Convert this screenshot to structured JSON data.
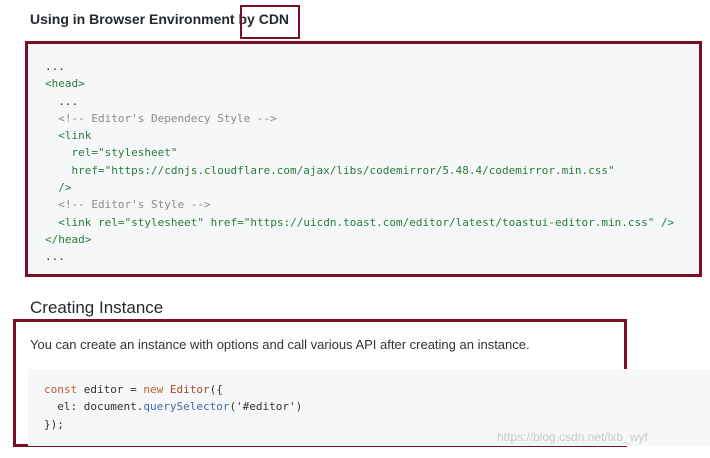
{
  "section_heading": {
    "text_before": "Using in Browser Environment b",
    "text_after": "y CDN"
  },
  "code_block_1": {
    "line_1": "...",
    "line_2_tag": "<head>",
    "line_3": "...",
    "line_4_comment": "<!-- Editor's Dependecy Style -->",
    "line_5_tag": "<link",
    "line_6_attr": "rel=",
    "line_6_value": "\"stylesheet\"",
    "line_7_attr": "href=",
    "line_7_value": "\"https://cdnjs.cloudflare.com/ajax/libs/codemirror/5.48.4/codemirror.min.css\"",
    "line_8_tag": "/>",
    "line_9_comment": "<!-- Editor's Style -->",
    "line_10_tag_open": "<link",
    "line_10_attr_rel": "rel=",
    "line_10_value_rel": "\"stylesheet\"",
    "line_10_attr_href": "href=",
    "line_10_value_href": "\"https://uicdn.toast.com/editor/latest/toastui-editor.min.css\"",
    "line_10_tag_close": "/>",
    "line_11_tag": "</head>",
    "line_12": "..."
  },
  "creating_instance": {
    "title": "Creating Instance",
    "description": "You can create an instance with options and call various API after creating an instance."
  },
  "code_block_2": {
    "line_1_kw_const": "const",
    "line_1_var": "editor =",
    "line_1_kw_new": "new",
    "line_1_class": "Editor",
    "line_1_punct": "({",
    "line_2_prop": "el: document.",
    "line_2_fn": "querySelector",
    "line_2_arg": "('#editor')",
    "line_3": "});"
  },
  "watermark": "https://blog.csdn.net/lxb_wyf",
  "colors": {
    "highlight_border": "#7b0d24",
    "code_background": "#f5f7f8",
    "code_tag": "#2a7a3d",
    "code_comment": "#8a8a8a",
    "code_keyword": "#c45a3c",
    "code_function": "#3c6ab4"
  }
}
